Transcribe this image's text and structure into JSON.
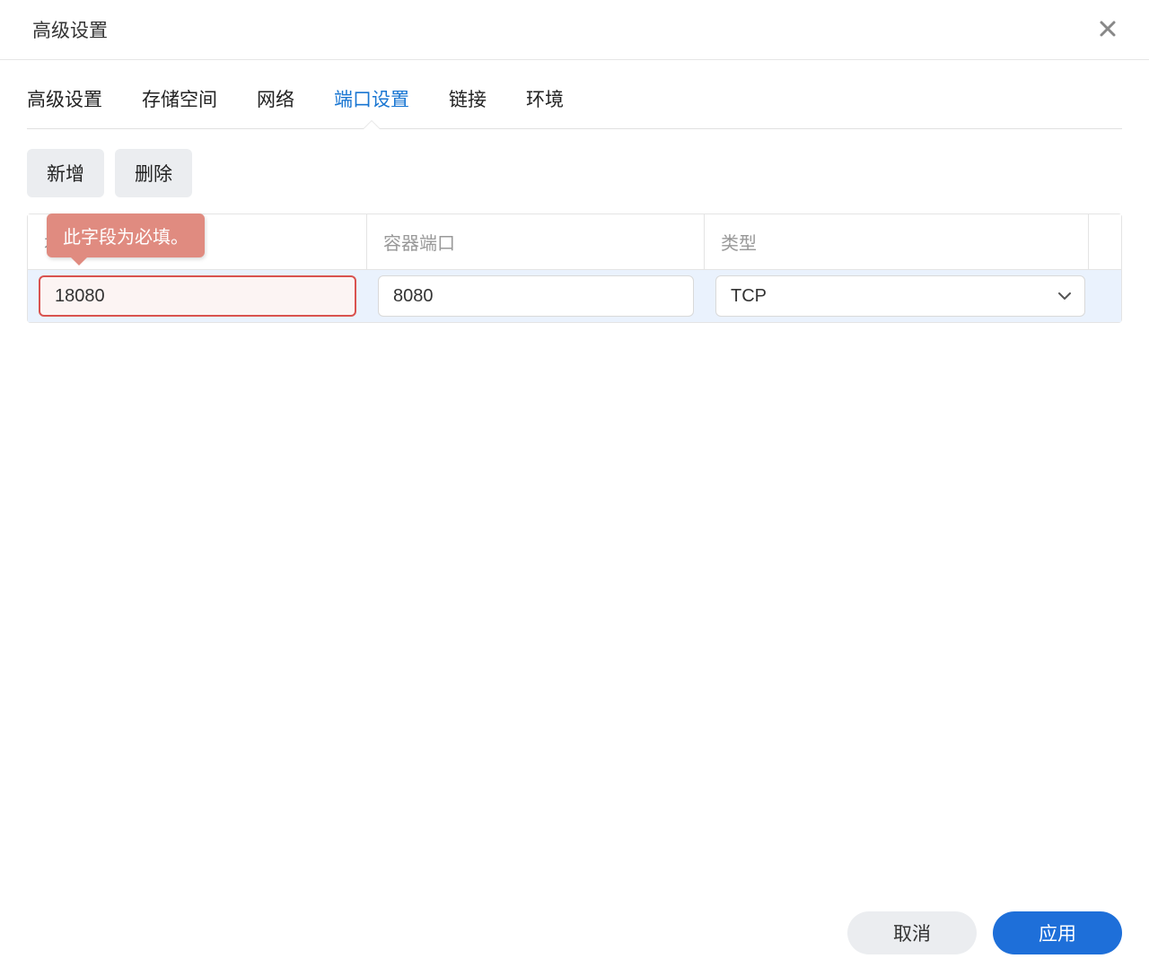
{
  "dialog": {
    "title": "高级设置"
  },
  "tabs": {
    "items": [
      {
        "label": "高级设置"
      },
      {
        "label": "存储空间"
      },
      {
        "label": "网络"
      },
      {
        "label": "端口设置"
      },
      {
        "label": "链接"
      },
      {
        "label": "环境"
      }
    ],
    "active_index": 3
  },
  "toolbar": {
    "add_label": "新增",
    "delete_label": "删除"
  },
  "table": {
    "headers": {
      "local_port": "本地端口",
      "container_port": "容器端口",
      "type": "类型"
    },
    "rows": [
      {
        "local_port": "18080",
        "container_port": "8080",
        "type": "TCP"
      }
    ]
  },
  "validation": {
    "required_message": "此字段为必填。"
  },
  "footer": {
    "cancel_label": "取消",
    "apply_label": "应用"
  }
}
